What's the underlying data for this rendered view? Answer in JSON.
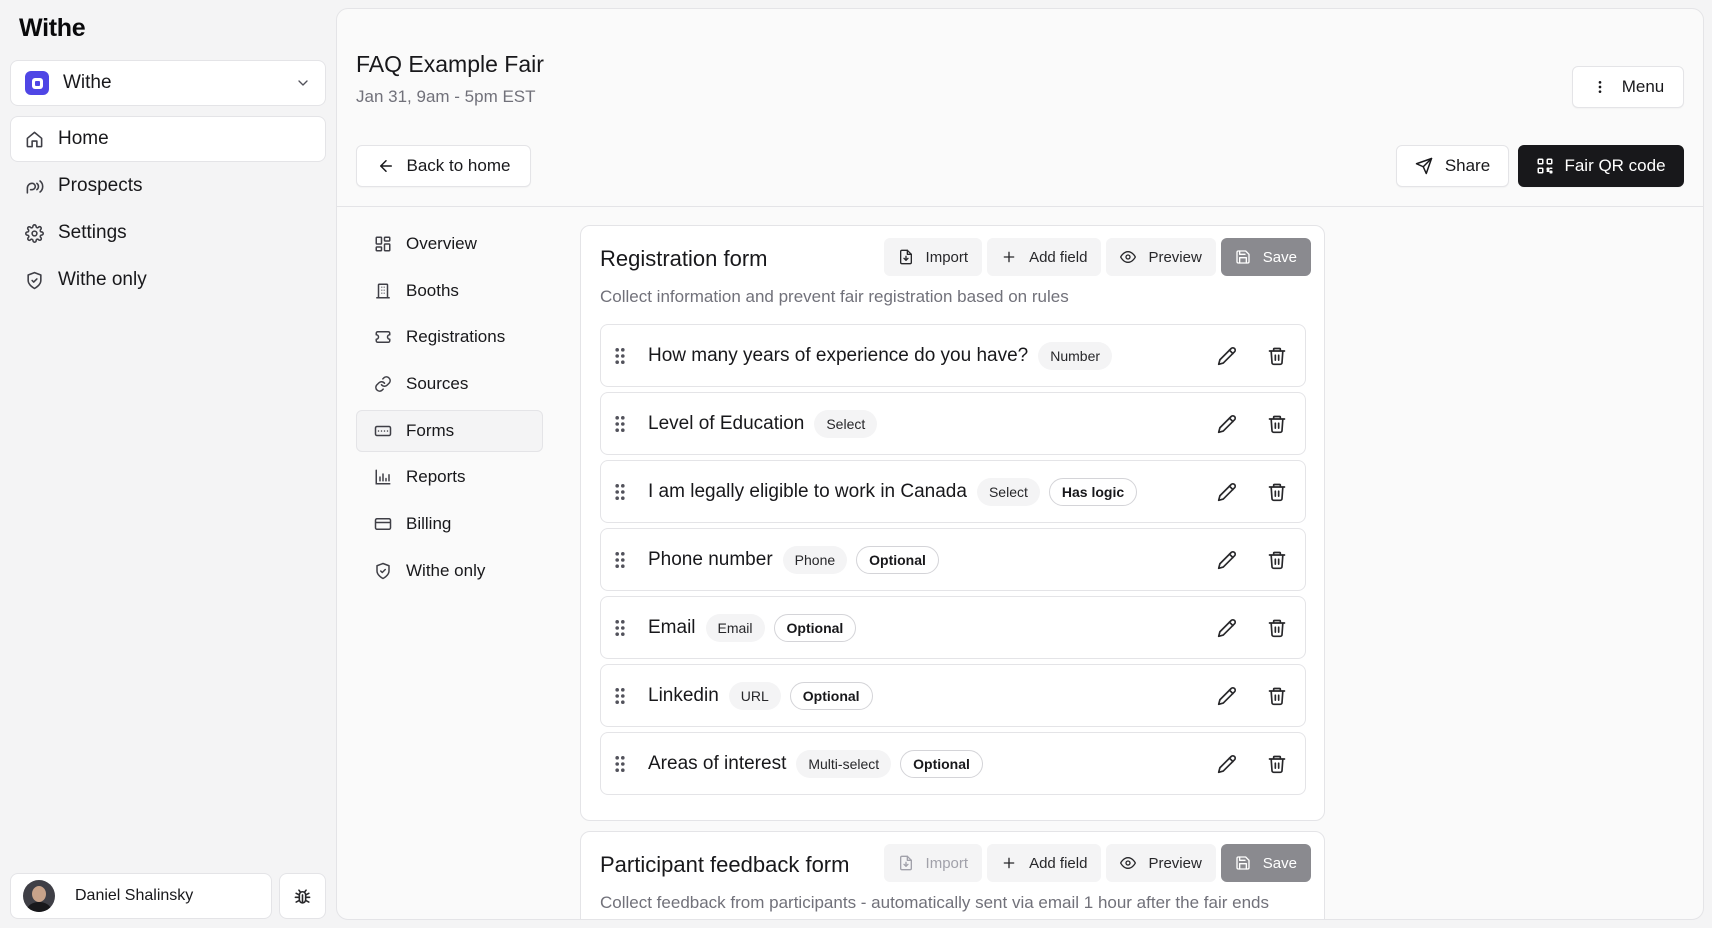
{
  "app": {
    "name": "Withe"
  },
  "workspace": {
    "name": "Withe",
    "icon": "chevron-down-icon"
  },
  "app_nav": [
    {
      "label": "Home",
      "icon": "home-icon",
      "active": true
    },
    {
      "label": "Prospects",
      "icon": "prospects-icon",
      "active": false
    },
    {
      "label": "Settings",
      "icon": "gear-icon",
      "active": false
    },
    {
      "label": "Withe only",
      "icon": "shield-icon",
      "active": false
    }
  ],
  "user": {
    "name": "Daniel Shalinsky"
  },
  "page": {
    "title": "FAQ Example Fair",
    "subtitle": "Jan 31, 9am - 5pm EST",
    "menu_label": "Menu",
    "back_label": "Back to home",
    "share_label": "Share",
    "qr_label": "Fair QR code"
  },
  "sub_nav": [
    {
      "label": "Overview",
      "icon": "grid-icon"
    },
    {
      "label": "Booths",
      "icon": "building-icon"
    },
    {
      "label": "Registrations",
      "icon": "ticket-icon"
    },
    {
      "label": "Sources",
      "icon": "link-icon"
    },
    {
      "label": "Forms",
      "icon": "form-icon",
      "active": true
    },
    {
      "label": "Reports",
      "icon": "bar-chart-icon"
    },
    {
      "label": "Billing",
      "icon": "credit-card-icon"
    },
    {
      "label": "Withe only",
      "icon": "shield-icon"
    }
  ],
  "forms": [
    {
      "title": "Registration form",
      "description": "Collect information and prevent fair registration based on rules",
      "actions": {
        "import": "Import",
        "add_field": "Add field",
        "preview": "Preview",
        "save": "Save"
      },
      "fields": [
        {
          "label": "How many years of experience do you have?",
          "type": "Number"
        },
        {
          "label": "Level of Education",
          "type": "Select"
        },
        {
          "label": "I am legally eligible to work in Canada",
          "type": "Select",
          "flag": "Has logic"
        },
        {
          "label": "Phone number",
          "type": "Phone",
          "flag": "Optional"
        },
        {
          "label": "Email",
          "type": "Email",
          "flag": "Optional"
        },
        {
          "label": "Linkedin",
          "type": "URL",
          "flag": "Optional"
        },
        {
          "label": "Areas of interest",
          "type": "Multi-select",
          "flag": "Optional"
        }
      ]
    },
    {
      "title": "Participant feedback form",
      "description": "Collect feedback from participants - automatically sent via email 1 hour after the fair ends",
      "actions": {
        "import": "Import",
        "add_field": "Add field",
        "preview": "Preview",
        "save": "Save"
      }
    }
  ],
  "colors": {
    "accent": "#4f46e5",
    "primary_button": "#18181b",
    "save_button": "#8a8a8f"
  }
}
